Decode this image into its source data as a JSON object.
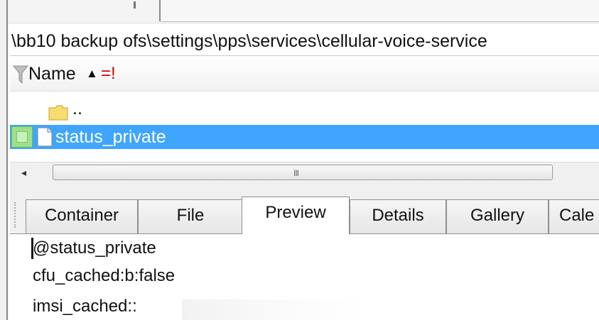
{
  "path_bar": {
    "text": "\\bb10 backup ofs\\settings\\pps\\services\\cellular-voice-service"
  },
  "file_list": {
    "column_header": {
      "name_label": "Name",
      "sort_indicator": "▲",
      "filter_operator": "=!"
    },
    "rows": [
      {
        "label": "..",
        "icon": "folder-icon",
        "selected": false
      },
      {
        "label": "status_private",
        "icon": "file-icon",
        "selected": true
      }
    ]
  },
  "scrollbar": {
    "left_arrow": "◂",
    "grip": "III"
  },
  "tabs": [
    {
      "label": "Container",
      "active": false
    },
    {
      "label": "File",
      "active": false
    },
    {
      "label": "Preview",
      "active": true
    },
    {
      "label": "Details",
      "active": false
    },
    {
      "label": "Gallery",
      "active": false
    },
    {
      "label": "Cale",
      "active": false
    }
  ],
  "preview": {
    "lines": [
      "@status_private",
      "cfu_cached:b:false",
      "imsi_cached::"
    ]
  },
  "colors": {
    "selection": "#3fa5ff",
    "filter_operator": "#d00000",
    "checkbox": "#9ee08a"
  }
}
